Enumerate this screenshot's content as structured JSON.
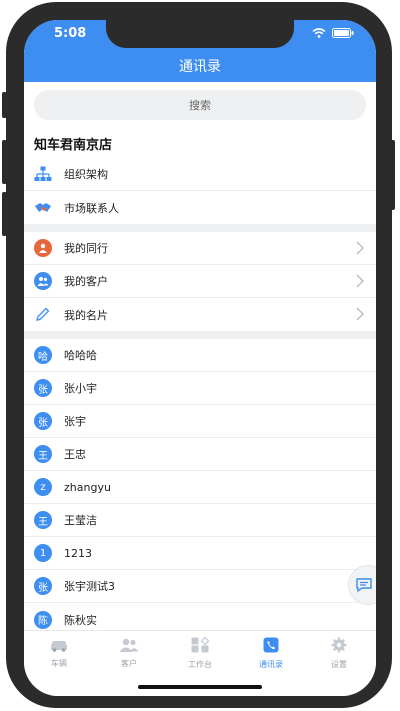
{
  "status": {
    "time": "5:08"
  },
  "header": {
    "title": "通讯录"
  },
  "search": {
    "label": "搜索"
  },
  "store": {
    "name": "知车君南京店"
  },
  "org_items": [
    {
      "label": "组织架构",
      "icon": "org-chart-icon"
    },
    {
      "label": "市场联系人",
      "icon": "handshake-icon"
    }
  ],
  "my_items": [
    {
      "label": "我的同行",
      "icon": "peer-icon"
    },
    {
      "label": "我的客户",
      "icon": "customers-icon"
    },
    {
      "label": "我的名片",
      "icon": "pencil-icon"
    }
  ],
  "contacts": [
    {
      "initial": "哈",
      "name": "哈哈哈"
    },
    {
      "initial": "张",
      "name": "张小宇"
    },
    {
      "initial": "张",
      "name": "张宇"
    },
    {
      "initial": "王",
      "name": "王忠"
    },
    {
      "initial": "z",
      "name": "zhangyu"
    },
    {
      "initial": "王",
      "name": "王莹洁"
    },
    {
      "initial": "1",
      "name": "1213"
    },
    {
      "initial": "张",
      "name": "张宇测试3"
    },
    {
      "initial": "陈",
      "name": "陈秋实"
    }
  ],
  "tabs": [
    {
      "label": "车辆",
      "icon": "car-icon"
    },
    {
      "label": "客户",
      "icon": "customers-icon"
    },
    {
      "label": "工作台",
      "icon": "workbench-icon"
    },
    {
      "label": "通讯录",
      "icon": "phonebook-icon",
      "active": true
    },
    {
      "label": "设置",
      "icon": "gear-icon"
    }
  ],
  "colors": {
    "accent": "#3d8ef0",
    "orange": "#e5673b"
  }
}
